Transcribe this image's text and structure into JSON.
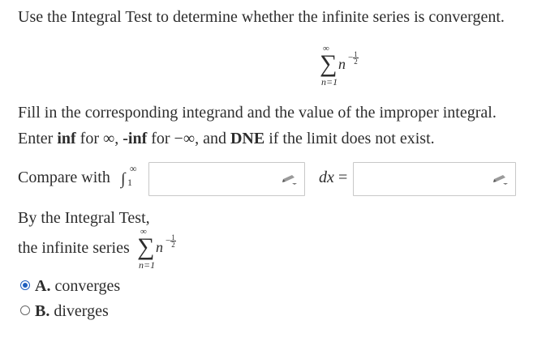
{
  "question": {
    "prompt": "Use the Integral Test to determine whether the infinite series is convergent.",
    "series": {
      "upper": "∞",
      "sigma": "∑",
      "lower": "n=1",
      "term": "n",
      "exp_sign": "−",
      "exp_num": "1",
      "exp_den": "2"
    }
  },
  "instructions": {
    "line1": "Fill in the corresponding integrand and the value of the improper integral.",
    "line2_pre": "Enter ",
    "inf": "inf",
    "line2_a": " for ∞, ",
    "neg_inf": "-inf",
    "line2_b": " for −∞, and ",
    "dne": "DNE",
    "line2_c": " if the limit does not exist."
  },
  "compare": {
    "label": "Compare with ",
    "integral_sign": "∫",
    "lower": "1",
    "upper": "∞",
    "dx": "dx",
    "equals": "=",
    "integrand_value": "",
    "result_value": ""
  },
  "conclusion": {
    "line1": "By the Integral Test,",
    "line2": "the infinite series "
  },
  "options": [
    {
      "letter": "A.",
      "text": " converges",
      "selected": true
    },
    {
      "letter": "B.",
      "text": " diverges",
      "selected": false
    }
  ],
  "colors": {
    "accent": "#1f5fbf",
    "text": "#2d2d2d",
    "box_border": "#c8c8c8"
  }
}
